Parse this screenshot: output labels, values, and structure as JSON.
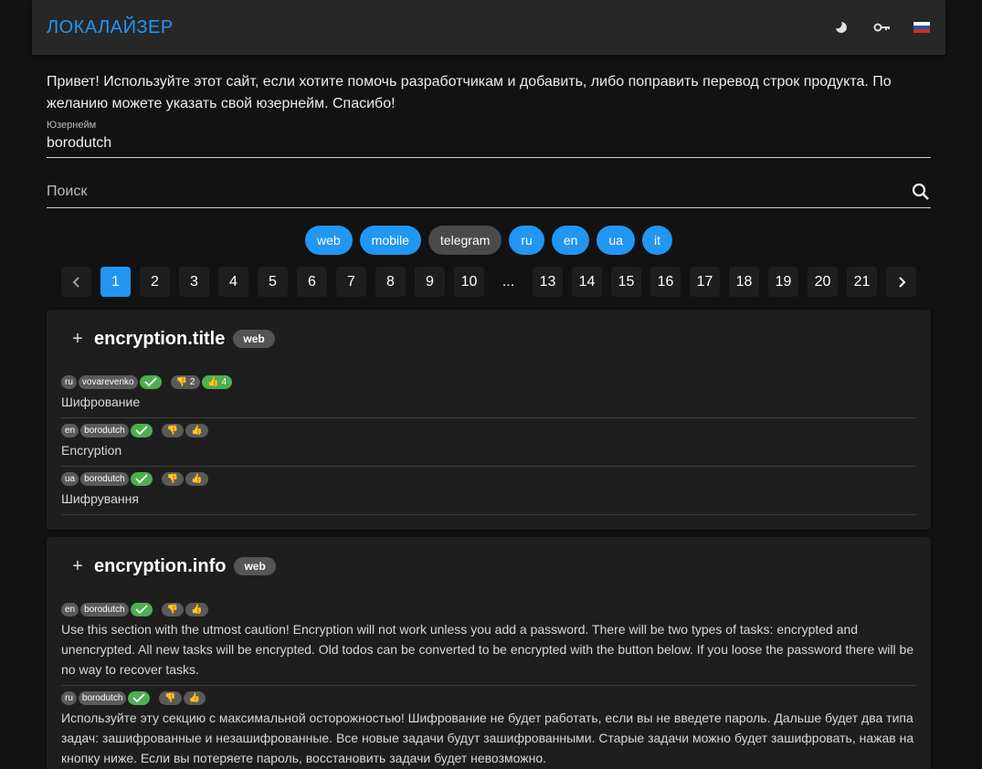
{
  "header": {
    "brand": "ЛОКАЛАЙЗЕР",
    "icons": [
      "moon-icon",
      "key-icon",
      "russian-flag-icon"
    ]
  },
  "intro": "Привет! Используйте этот сайт, если хотите помочь разработчикам и добавить, либо поправить перевод строк продукта. По желанию можете указать свой юзернейм. Спасибо!",
  "username": {
    "label": "Юзернейм",
    "value": "borodutch"
  },
  "search": {
    "placeholder": "Поиск"
  },
  "filters": [
    {
      "label": "web",
      "active": true
    },
    {
      "label": "mobile",
      "active": true
    },
    {
      "label": "telegram",
      "active": false
    },
    {
      "label": "ru",
      "active": true
    },
    {
      "label": "en",
      "active": true
    },
    {
      "label": "ua",
      "active": true
    },
    {
      "label": "it",
      "active": true
    }
  ],
  "pagination": {
    "current": "1",
    "pages": [
      "1",
      "2",
      "3",
      "4",
      "5",
      "6",
      "7",
      "8",
      "9",
      "10",
      "...",
      "13",
      "14",
      "15",
      "16",
      "17",
      "18",
      "19",
      "20",
      "21"
    ]
  },
  "cards": [
    {
      "key": "encryption.title",
      "tag": "web",
      "entries": [
        {
          "lang": "ru",
          "user": "vovarevenko",
          "down": "2",
          "up": "4",
          "up_active": true,
          "text": "Шифрование"
        },
        {
          "lang": "en",
          "user": "borodutch",
          "down": "",
          "up": "",
          "up_active": false,
          "text": "Encryption"
        },
        {
          "lang": "ua",
          "user": "borodutch",
          "down": "",
          "up": "",
          "up_active": false,
          "text": "Шифрування"
        }
      ]
    },
    {
      "key": "encryption.info",
      "tag": "web",
      "entries": [
        {
          "lang": "en",
          "user": "borodutch",
          "down": "",
          "up": "",
          "up_active": false,
          "text": "Use this section with the utmost caution! Encryption will not work unless you add a password. There will be two types of tasks: encrypted and unencrypted. All new tasks will be encrypted. Old todos can be converted to be encrypted with the button below. If you loose the password there will be no way to recover tasks."
        },
        {
          "lang": "ru",
          "user": "borodutch",
          "down": "",
          "up": "",
          "up_active": false,
          "text": "Используйте эту секцию с максимальной осторожностью! Шифрование не будет работать, если вы не введете пароль. Дальше будет два типа задач: зашифрованные и незашифрованные. Все новые задачи будут зашифрованными. Старые задачи можно будет зашифровать, нажав на кнопку ниже. Если вы потеряете пароль, восстановить задачи будет невозможно."
        }
      ]
    }
  ],
  "colors": {
    "accent": "#2196f3",
    "approved": "#4caf50",
    "background": "#121212",
    "surface": "#1e1e1e"
  }
}
